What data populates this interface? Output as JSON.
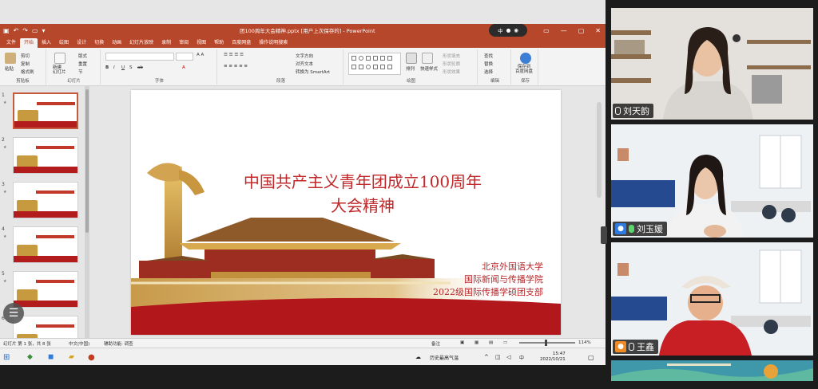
{
  "powerpoint": {
    "file_title": "团100周年大会精神.pptx [用户上次保存的] - PowerPoint",
    "zoom_pill_label": "中",
    "menu_tabs": [
      "文件",
      "开始",
      "插入",
      "绘图",
      "设计",
      "切换",
      "动画",
      "幻灯片放映",
      "录制",
      "审阅",
      "视图",
      "帮助",
      "百度网盘",
      "操作说明搜索"
    ],
    "active_tab": "开始",
    "ribbon": {
      "clipboard": {
        "label": "剪贴板",
        "paste": "粘贴",
        "cut": "剪切",
        "copy": "复制",
        "format_painter": "格式刷"
      },
      "slides": {
        "label": "幻灯片",
        "new_slide": "新建\n幻灯片",
        "layout": "版式",
        "reset": "重置",
        "section": "节"
      },
      "font": {
        "label": "字体"
      },
      "paragraph": {
        "label": "段落",
        "text_direction": "文字方向",
        "align_text": "对齐文本",
        "smartart": "转换为 SmartArt"
      },
      "drawing": {
        "label": "绘图",
        "arrange": "排列",
        "quick_styles": "快速样式",
        "shape_fill": "形状填充",
        "shape_outline": "形状轮廓",
        "shape_effects": "形状效果"
      },
      "editing": {
        "label": "编辑",
        "find": "查找",
        "replace": "替换",
        "select": "选择"
      },
      "save": {
        "label": "保存",
        "save_to_baidu": "保存到\n百度网盘"
      }
    },
    "thumbnails": [
      {
        "num": "1",
        "star": "★"
      },
      {
        "num": "2",
        "star": "★"
      },
      {
        "num": "3",
        "star": "★"
      },
      {
        "num": "4",
        "star": "★"
      },
      {
        "num": "5",
        "star": "★"
      },
      {
        "num": "6",
        "star": ""
      }
    ],
    "slide": {
      "title": "中国共产主义青年团成立100周年\n大会精神",
      "org_line1": "北京外国语大学",
      "org_line2": "国际新闻与传播学院",
      "org_line3": "2022级国际传播学硕团支部"
    },
    "status": {
      "slide_count": "幻灯片 第 1 张，共 8 张",
      "language": "中文(中国)",
      "accessibility": "辅助功能: 调查",
      "notes": "备注",
      "zoom": "114%"
    },
    "taskbar": {
      "weather": "历史最高气温",
      "time": "15:47",
      "date": "2022/10/21",
      "input_method": "中"
    }
  },
  "participants": [
    {
      "name": "刘天韵",
      "muted": true,
      "active": false
    },
    {
      "name": "刘玉媛",
      "muted": false,
      "active": true
    },
    {
      "name": "王鑫",
      "muted": true,
      "active": false
    }
  ],
  "colors": {
    "ppt_accent": "#b7472a",
    "slide_red": "#c0282a",
    "speaker_green": "#52c26a"
  }
}
